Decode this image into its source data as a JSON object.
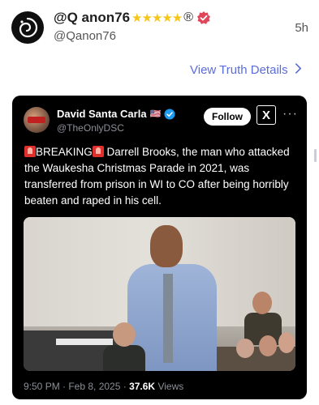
{
  "post": {
    "display_name": "@Q anon76",
    "stars": "★★★★★",
    "registered_mark": "®",
    "handle": "@Qanon76",
    "time_ago": "5h",
    "view_details_label": "View Truth Details"
  },
  "embed": {
    "author_name": "David Santa Carla",
    "author_flag": "🇺🇸",
    "author_handle": "@TheOnlyDSC",
    "follow_label": "Follow",
    "x_logo_label": "X",
    "more_label": "···",
    "text_breaking": "BREAKING",
    "text_body": " Darrell Brooks, the man who attacked the Waukesha Christmas Parade in 2021, was transferred from prison in WI to CO after being horribly beaten and raped in his cell.",
    "timestamp": "9:50 PM · Feb 8, 2025 · ",
    "views_count": "37.6K",
    "views_label": " Views"
  },
  "colors": {
    "accent_link": "#5a6dd8",
    "star": "#f5c518",
    "verified_red": "#e0465a",
    "verified_blue": "#1d9bf0",
    "embed_bg": "#000000"
  },
  "icons": {
    "avatar": "swirl-logo-icon",
    "verified": "verified-badge-icon",
    "chevron": "chevron-right-icon",
    "siren": "siren-emoji-icon",
    "x_logo": "x-logo-icon"
  }
}
